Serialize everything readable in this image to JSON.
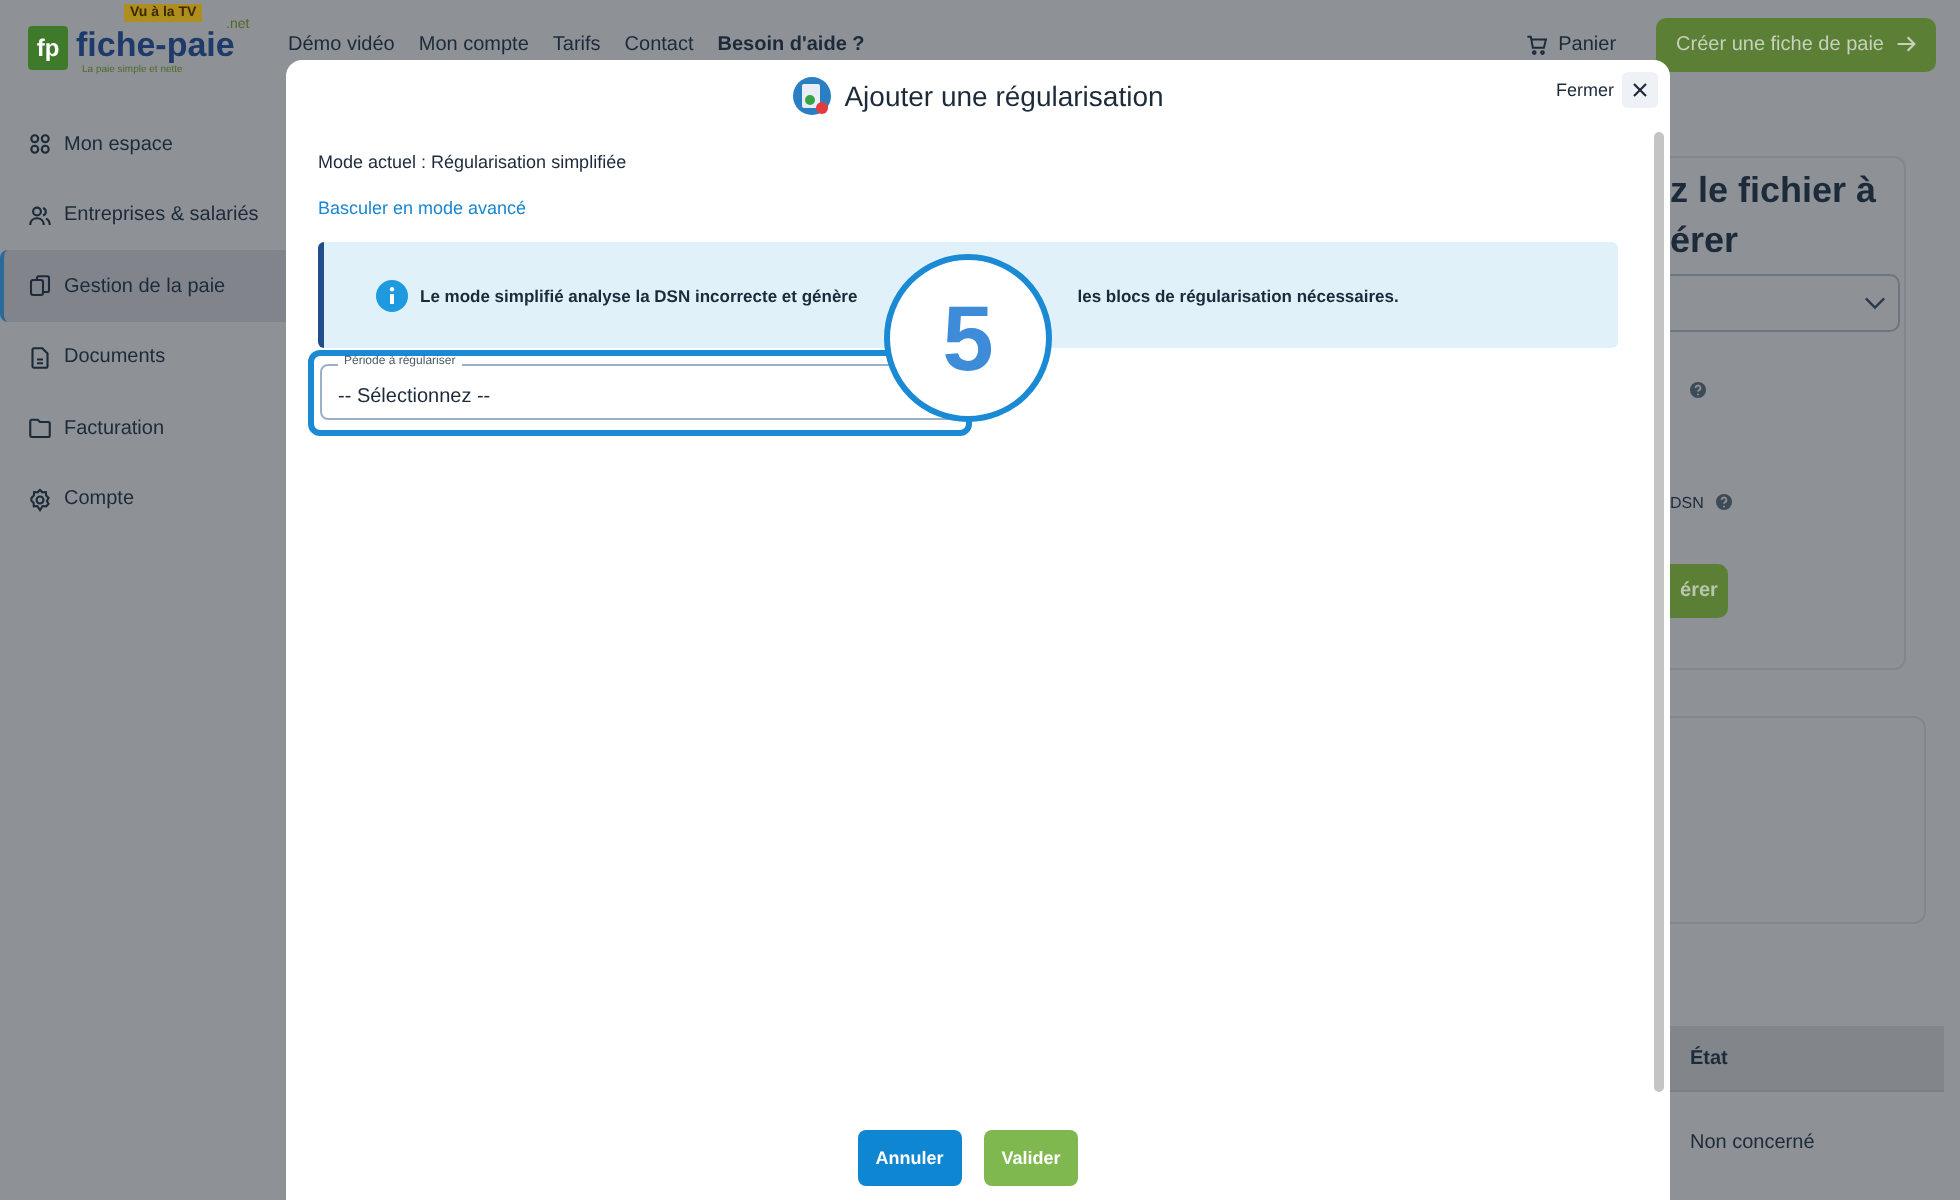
{
  "header": {
    "logo": {
      "mark": "fp",
      "name": "fiche-paie",
      "suffix": ".net",
      "badge": "Vu à la TV",
      "tagline": "La paie simple et nette"
    },
    "nav": [
      "Démo vidéo",
      "Mon compte",
      "Tarifs",
      "Contact",
      "Besoin d'aide ?"
    ],
    "cart": "Panier",
    "cta": "Créer une fiche de paie"
  },
  "sidebar": {
    "items": [
      {
        "label": "Mon espace",
        "selected": false
      },
      {
        "label": "Entreprises & salariés",
        "selected": false
      },
      {
        "label": "Gestion de la paie",
        "selected": true
      },
      {
        "label": "Documents",
        "selected": false
      },
      {
        "label": "Facturation",
        "selected": false
      },
      {
        "label": "Compte",
        "selected": false
      }
    ]
  },
  "background_panel": {
    "title_lines": [
      "z le fichier à",
      "érer"
    ],
    "help_label": "DSN",
    "button": "érer",
    "table_header": "État",
    "table_cell": "Non concerné"
  },
  "dialog": {
    "title": "Ajouter une régularisation",
    "close_label": "Fermer",
    "mode_label": "Mode actuel : Régularisation simplifiée",
    "switch_link": "Basculer en mode avancé",
    "info": {
      "before": "Le mode simplifié analyse la DSN incorrecte et génère",
      "after": "les blocs de régularisation nécessaires."
    },
    "field": {
      "label": "Période à régulariser",
      "value": "-- Sélectionnez --"
    },
    "callout": "5",
    "buttons": [
      {
        "label": "Annuler",
        "kind": "cancel"
      },
      {
        "label": "Valider",
        "kind": "confirm"
      }
    ]
  }
}
